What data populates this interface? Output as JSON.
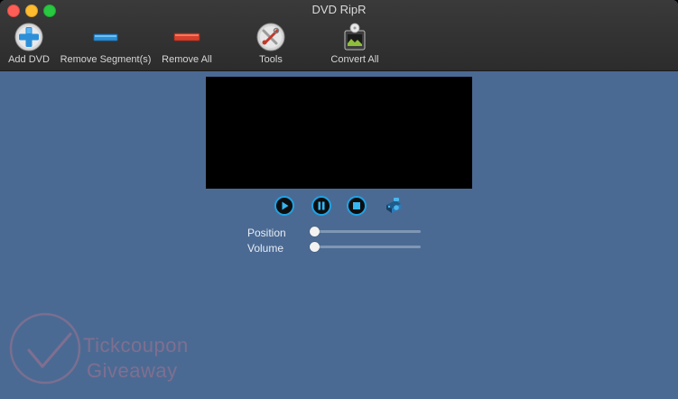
{
  "window": {
    "title": "DVD RipR"
  },
  "toolbar": {
    "add_dvd": "Add DVD",
    "remove_segments": "Remove Segment(s)",
    "remove_all": "Remove All",
    "tools": "Tools",
    "convert_all": "Convert All"
  },
  "player": {
    "position_label": "Position",
    "volume_label": "Volume",
    "position_value": 0,
    "volume_value": 0
  },
  "watermark": {
    "line1": "Tickcoupon",
    "line2": "Giveaway"
  },
  "colors": {
    "window_bg": "#4b6a93",
    "toolbar_bg": "#2e2e2e",
    "accent_blue": "#1ea3e6"
  }
}
